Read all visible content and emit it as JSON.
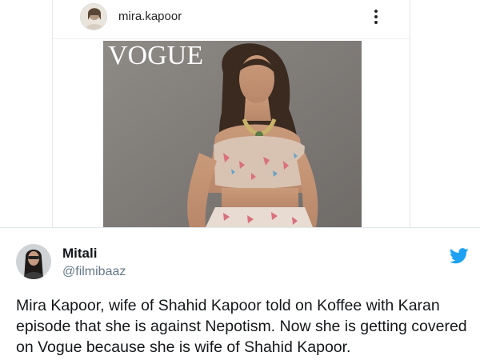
{
  "instagram_embed": {
    "username": "mira.kapoor",
    "more_icon": "more-vertical-icon",
    "photo_logo": "VOGUE"
  },
  "tweet": {
    "author_name": "Mitali",
    "author_handle": "@filmibaaz",
    "text": "Mira Kapoor, wife of Shahid Kapoor told on Koffee with Karan episode that she is against Nepotism. Now she is getting covered on Vogue because she is wife of Shahid Kapoor.",
    "brand_icon": "twitter-bird-icon",
    "brand_color": "#1da1f2"
  }
}
